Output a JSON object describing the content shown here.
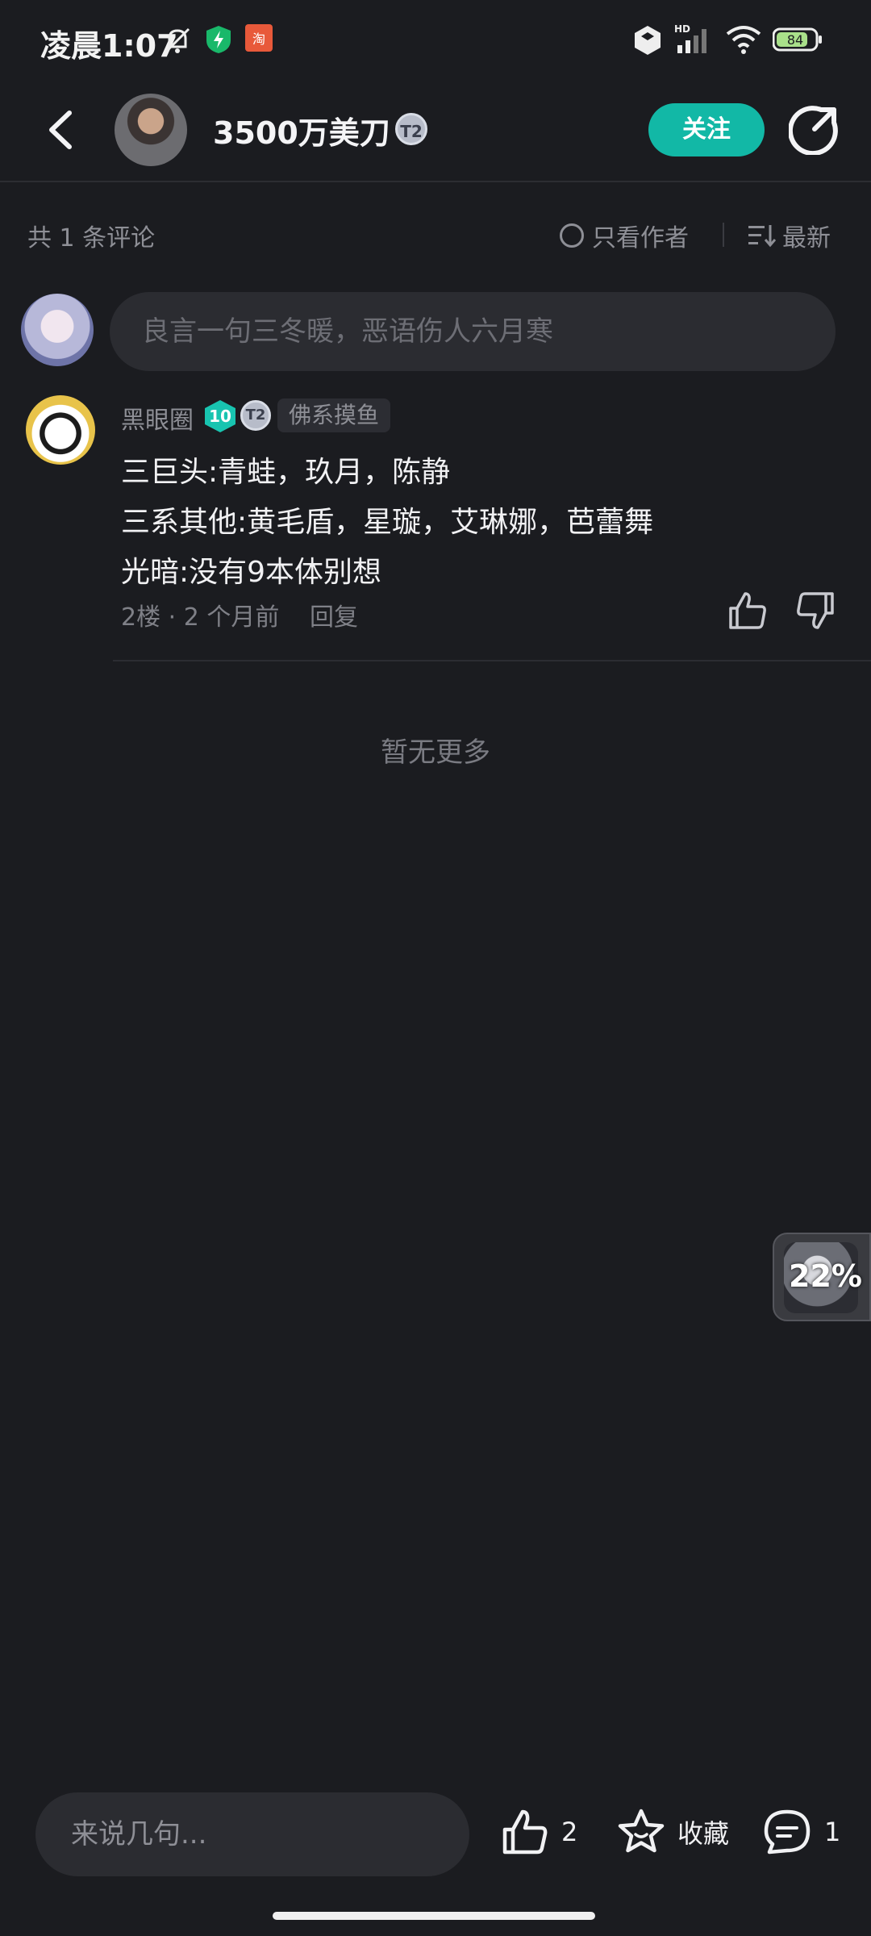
{
  "status_bar": {
    "time": "凌晨1:07",
    "battery": "84",
    "network": "HD"
  },
  "header": {
    "title": "3500万美刀",
    "badge": "T2",
    "follow_label": "关注"
  },
  "filter": {
    "count_label": "共 1 条评论",
    "only_author_label": "只看作者",
    "sort_label": "最新"
  },
  "comment_input": {
    "placeholder": "良言一句三冬暖，恶语伤人六月寒"
  },
  "comment": {
    "username": "黑眼圈",
    "level": "10",
    "badge": "T2",
    "tag": "佛系摸鱼",
    "lines": [
      "三巨头:青蛙，玖月，陈静",
      "三系其他:黄毛盾，星璇，艾琳娜，芭蕾舞",
      "光暗:没有9本体别想"
    ],
    "meta": "2楼 · 2 个月前",
    "reply_label": "回复"
  },
  "no_more_label": "暂无更多",
  "floating": {
    "progress_label": "22%",
    "progress_value": 22
  },
  "bottom_bar": {
    "input_placeholder": "来说几句...",
    "like_count": "2",
    "favorite_label": "收藏",
    "comment_count": "1"
  }
}
